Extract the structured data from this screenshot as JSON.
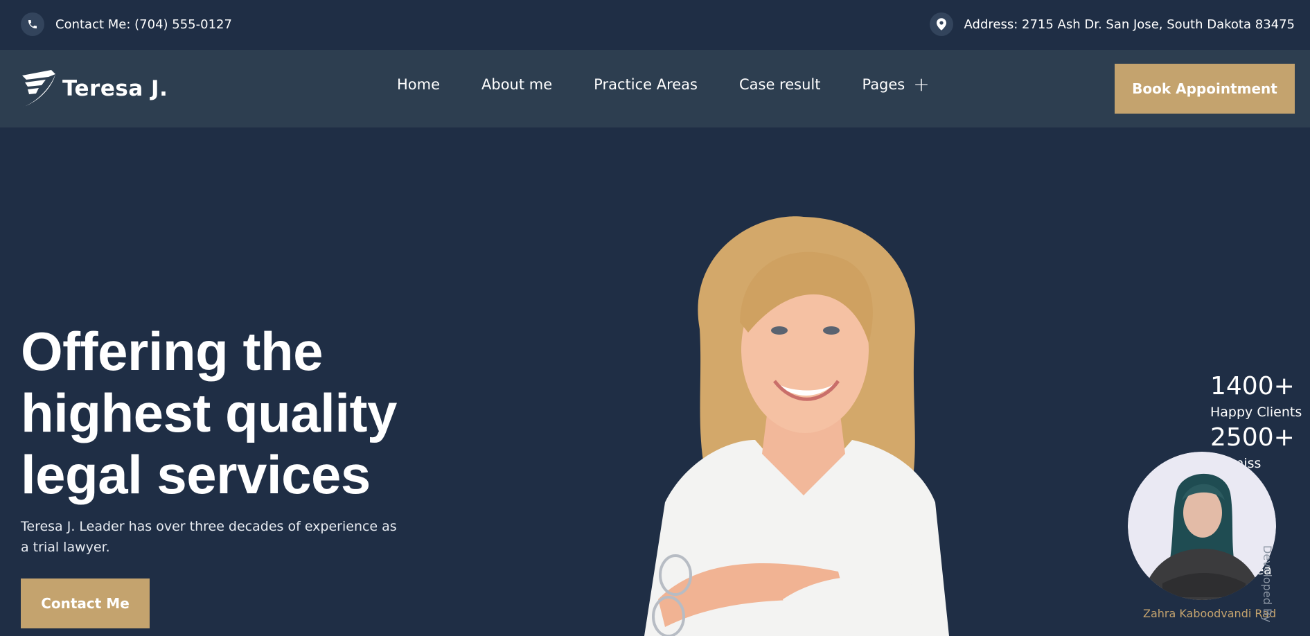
{
  "topbar": {
    "contact": "Contact Me: (704) 555-0127",
    "contact_icon": "phone-icon",
    "address": "Address: 2715 Ash Dr. San Jose, South Dakota 83475",
    "address_icon": "location-pin-icon"
  },
  "nav": {
    "logo_text": "Teresa J.",
    "links": [
      "Home",
      "About me",
      "Practice Areas",
      "Case result",
      "Pages"
    ],
    "pages_icon": "plus-icon",
    "cta": "Book Appointment"
  },
  "hero": {
    "title": "Offering the highest quality legal services",
    "description": "Teresa J. Leader has over three decades of experience as a trial lawyer.",
    "cta": "Contact Me"
  },
  "stats": [
    {
      "number": "1400+",
      "label": "Happy Clients"
    },
    {
      "number": "2500+",
      "label": "Dismiss"
    },
    {
      "label": "rea"
    }
  ],
  "developer": {
    "name": "Zahra Kaboodvandi Rad",
    "credit": "Developed By"
  },
  "colors": {
    "background": "#1f2e45",
    "navbar": "#2d3e50",
    "accent": "#c4a36e"
  }
}
